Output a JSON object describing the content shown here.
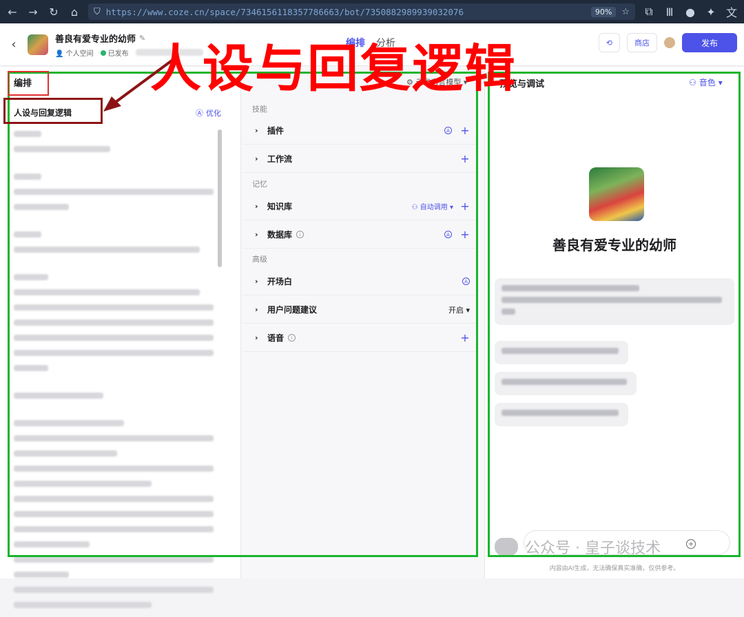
{
  "browser": {
    "url": "https://www.coze.cn/space/7346156118357786663/bot/7350882989939032076",
    "zoom": "90%"
  },
  "bot": {
    "name": "善良有爱专业的幼师",
    "space": "个人空间",
    "status": "已发布"
  },
  "header": {
    "tabs": [
      "编排",
      "分析"
    ],
    "active_tab": "编排",
    "ops_label": "商店",
    "publish_label": "发布"
  },
  "overlay_title": "人设与回复逻辑",
  "left": {
    "section_title": "编排",
    "persona_title": "人设与回复逻辑",
    "optimize_label": "优化"
  },
  "middle": {
    "model_selector": "云雀语言模型",
    "groups": [
      {
        "label": "技能"
      },
      {
        "label": "记忆"
      },
      {
        "label": "高级"
      }
    ],
    "items": {
      "plugins": "插件",
      "workflow": "工作流",
      "knowledge": "知识库",
      "knowledge_tag": "自动调用",
      "database": "数据库",
      "opener": "开场白",
      "suggestions": "用户问题建议",
      "suggestions_value": "开启",
      "voice": "语音"
    }
  },
  "right": {
    "title": "预览与调试",
    "voice_label": "音色",
    "bot_name": "善良有爱专业的幼师",
    "watermark": "公众号 · 皇子谈技术",
    "disclaimer": "内容由AI生成，无法确保真实准确，仅供参考。"
  }
}
